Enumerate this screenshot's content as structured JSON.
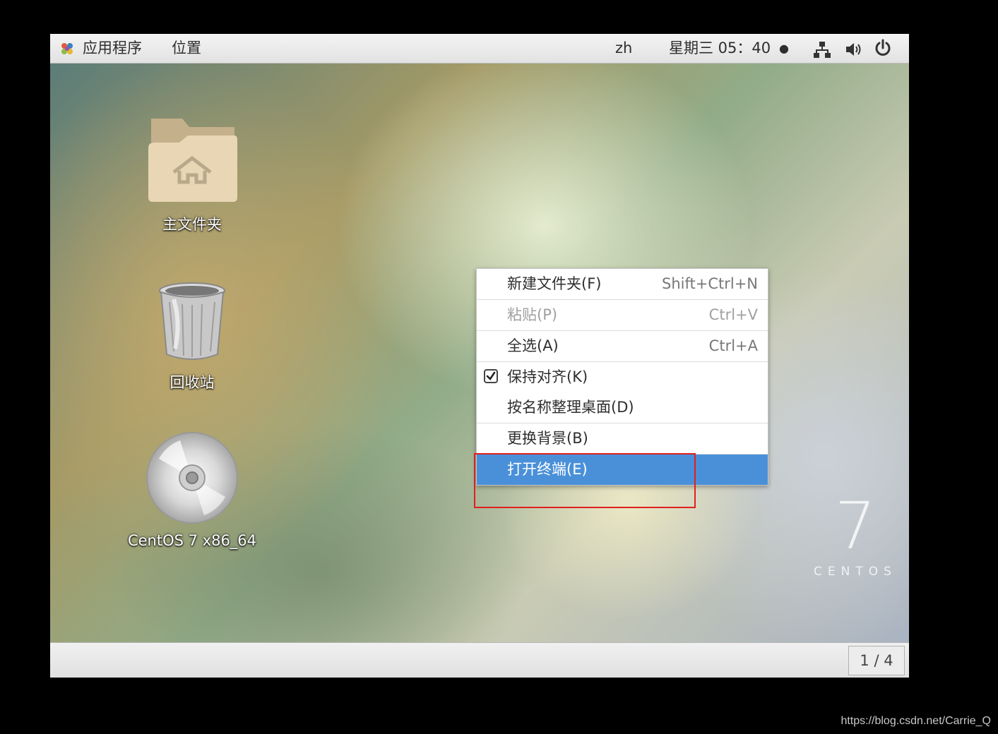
{
  "topbar": {
    "applications": "应用程序",
    "places": "位置",
    "input_method": "zh",
    "clock": "星期三 05：40",
    "clock_dot": "●",
    "icons": [
      "gnome-apps-icon",
      "network-icon",
      "volume-icon",
      "power-icon"
    ]
  },
  "desktop": {
    "icons": [
      {
        "label": "主文件夹",
        "icon": "home-folder-icon"
      },
      {
        "label": "回收站",
        "icon": "trash-icon"
      },
      {
        "label": "CentOS 7 x86_64",
        "icon": "cdrom-icon"
      }
    ],
    "logo_seven": "7",
    "logo_text": "CENTOS"
  },
  "context_menu": {
    "items": [
      {
        "label": "新建文件夹(F)",
        "accel": "Shift+Ctrl+N",
        "state": "enabled"
      },
      {
        "label": "粘贴(P)",
        "accel": "Ctrl+V",
        "state": "disabled"
      },
      {
        "label": "全选(A)",
        "accel": "Ctrl+A",
        "state": "enabled"
      },
      {
        "label": "保持对齐(K)",
        "accel": "",
        "state": "checked"
      },
      {
        "label": "按名称整理桌面(D)",
        "accel": "",
        "state": "enabled"
      },
      {
        "label": "更换背景(B)",
        "accel": "",
        "state": "enabled"
      },
      {
        "label": "打开终端(E)",
        "accel": "",
        "state": "selected"
      }
    ],
    "selected_color": "#4a90d9",
    "highlight_color": "#e0201e"
  },
  "bottombar": {
    "workspace": "1 / 4"
  },
  "watermark": "https://blog.csdn.net/Carrie_Q"
}
